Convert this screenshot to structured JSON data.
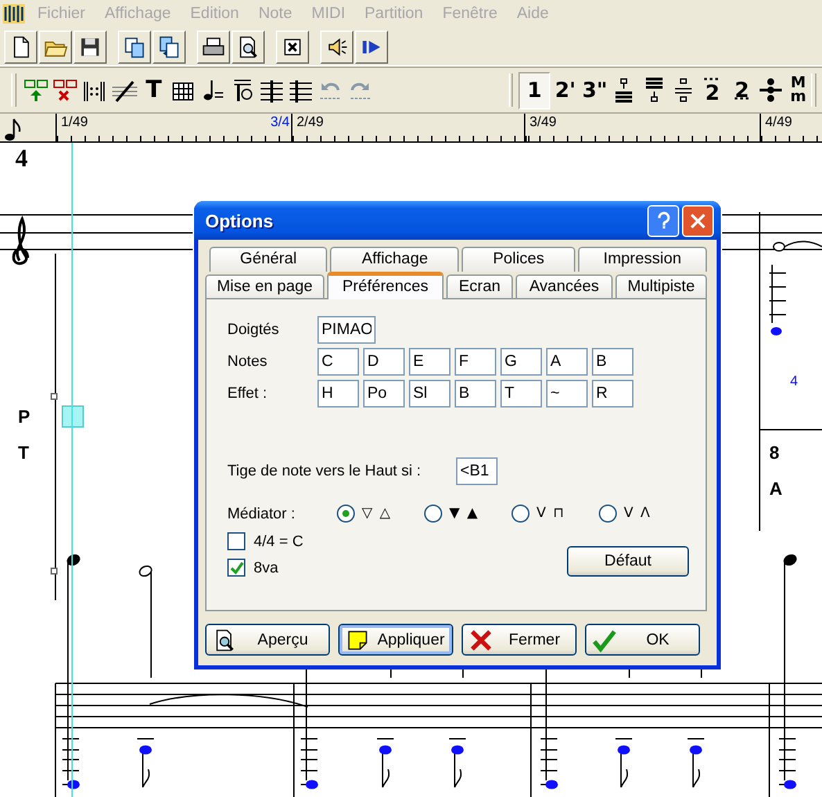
{
  "menu": [
    {
      "label": "Fichier",
      "disabled": true
    },
    {
      "label": "Affichage",
      "disabled": true
    },
    {
      "label": "Edition",
      "disabled": true
    },
    {
      "label": "Note",
      "disabled": true
    },
    {
      "label": "MIDI",
      "disabled": true
    },
    {
      "label": "Partition",
      "disabled": true
    },
    {
      "label": "Fenêtre",
      "disabled": true
    },
    {
      "label": "Aide",
      "disabled": true
    }
  ],
  "text_tool": "T",
  "duration_buttons": [
    {
      "label": "1",
      "selected": true
    },
    {
      "label": "2'",
      "selected": false
    },
    {
      "label": "3\"",
      "selected": false
    }
  ],
  "voice_buttons": [
    {
      "label": "2",
      "kind": "dotted"
    },
    {
      "label": "2",
      "kind": "double-dotted"
    },
    {
      "label": "M m",
      "kind": "stacked"
    }
  ],
  "ruler": [
    {
      "label": "1/49",
      "time": "3/4"
    },
    {
      "label": "2/49"
    },
    {
      "label": "3/49"
    },
    {
      "label": "4/49"
    }
  ],
  "score": {
    "time_signature": "4",
    "tab_labels": [
      "P",
      "T"
    ],
    "fret": "4",
    "measure_labels": [
      "8",
      "A"
    ]
  },
  "dialog": {
    "title": "Options",
    "tab_rows": [
      [
        {
          "label": "Général",
          "selected": false
        },
        {
          "label": "Affichage",
          "selected": false
        },
        {
          "label": "Polices",
          "selected": false
        },
        {
          "label": "Impression",
          "selected": false
        }
      ],
      [
        {
          "label": "Mise en page",
          "selected": false
        },
        {
          "label": "Préférences",
          "selected": true
        },
        {
          "label": "Ecran",
          "selected": false
        },
        {
          "label": "Avancées",
          "selected": false
        },
        {
          "label": "Multipiste",
          "selected": false
        }
      ]
    ],
    "fingering": {
      "label": "Doigtés",
      "value": "PIMAO"
    },
    "notes": {
      "label": "Notes",
      "values": [
        "C",
        "D",
        "E",
        "F",
        "G",
        "A",
        "B"
      ]
    },
    "effects": {
      "label": "Effet :",
      "values": [
        "H",
        "Po",
        "Sl",
        "B",
        "T",
        "~",
        "R"
      ]
    },
    "stem": {
      "label": "Tige de note vers le Haut si :",
      "value": "<B1"
    },
    "pick": {
      "label": "Médiator :",
      "options": [
        {
          "symbols": "▽ △",
          "selected": true
        },
        {
          "symbols": "▼ ▲",
          "selected": false
        },
        {
          "symbols": "V ⊓",
          "selected": false
        },
        {
          "symbols": "V Λ",
          "selected": false
        }
      ]
    },
    "checkboxes": [
      {
        "label": "4/4 = C",
        "checked": false
      },
      {
        "label": "8va",
        "checked": true
      }
    ],
    "default_button": "Défaut",
    "buttons": [
      {
        "label": "Aperçu",
        "kind": "preview",
        "focused": false
      },
      {
        "label": "Appliquer",
        "kind": "apply",
        "focused": true
      },
      {
        "label": "Fermer",
        "kind": "close",
        "focused": false
      },
      {
        "label": "OK",
        "kind": "ok",
        "focused": false
      }
    ]
  }
}
